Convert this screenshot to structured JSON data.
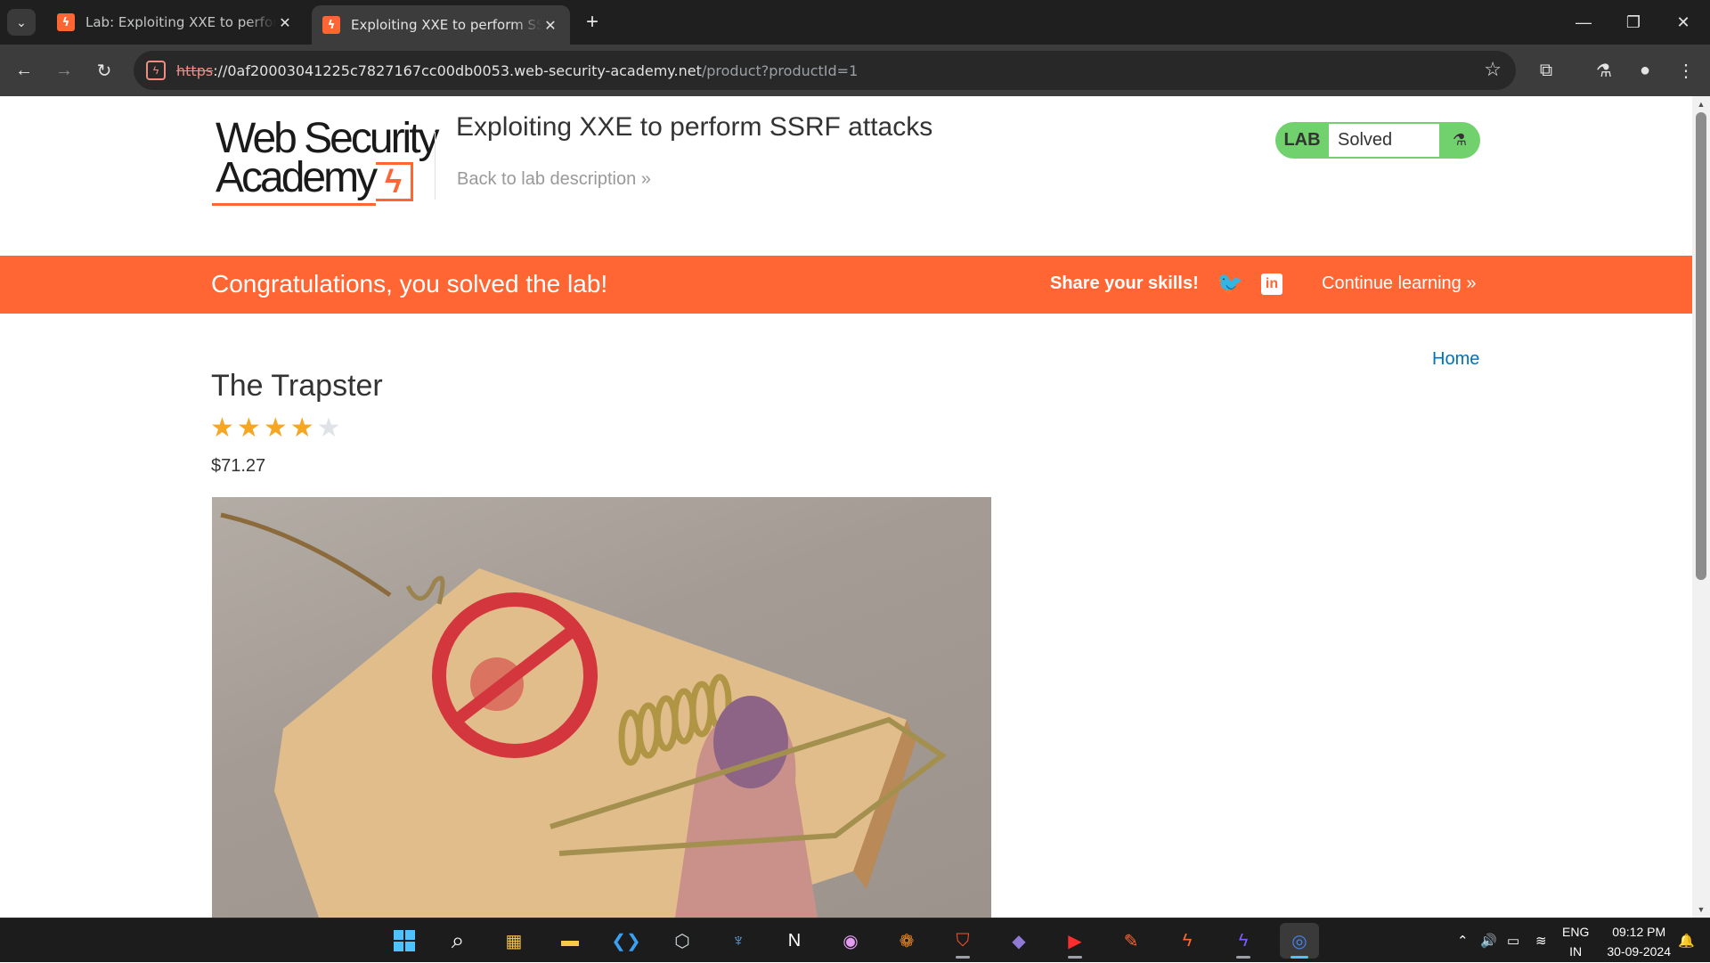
{
  "browser": {
    "tabs": [
      {
        "title": "Lab: Exploiting XXE to perform SSRF attacks",
        "favicon": "portswigger-favicon",
        "active": false
      },
      {
        "title": "Exploiting XXE to perform SSRF attacks",
        "favicon": "portswigger-favicon",
        "active": true
      }
    ],
    "url": {
      "scheme": "https",
      "host": "://0af20003041225c7827167cc00db0053.web-security-academy.net",
      "path": "/product?productId=1"
    }
  },
  "header": {
    "logo_line1": "Web Security",
    "logo_line2": "Academy",
    "lab_title": "Exploiting XXE to perform SSRF attacks",
    "back_link": "Back to lab description",
    "status_label": "LAB",
    "status_value": "Solved"
  },
  "banner": {
    "message": "Congratulations, you solved the lab!",
    "share": "Share your skills!",
    "continue": "Continue learning"
  },
  "nav": {
    "home": "Home"
  },
  "product": {
    "title": "The Trapster",
    "rating": 4,
    "rating_max": 5,
    "price": "$71.27"
  },
  "taskbar": {
    "lang_line1": "ENG",
    "lang_line2": "IN",
    "time": "09:12 PM",
    "date": "30-09-2024"
  },
  "colors": {
    "accent": "#ff6633",
    "lab_solved": "#70d16d",
    "link": "#0071bc",
    "star_filled": "#f5a623",
    "star_empty": "#dfe3e8"
  }
}
